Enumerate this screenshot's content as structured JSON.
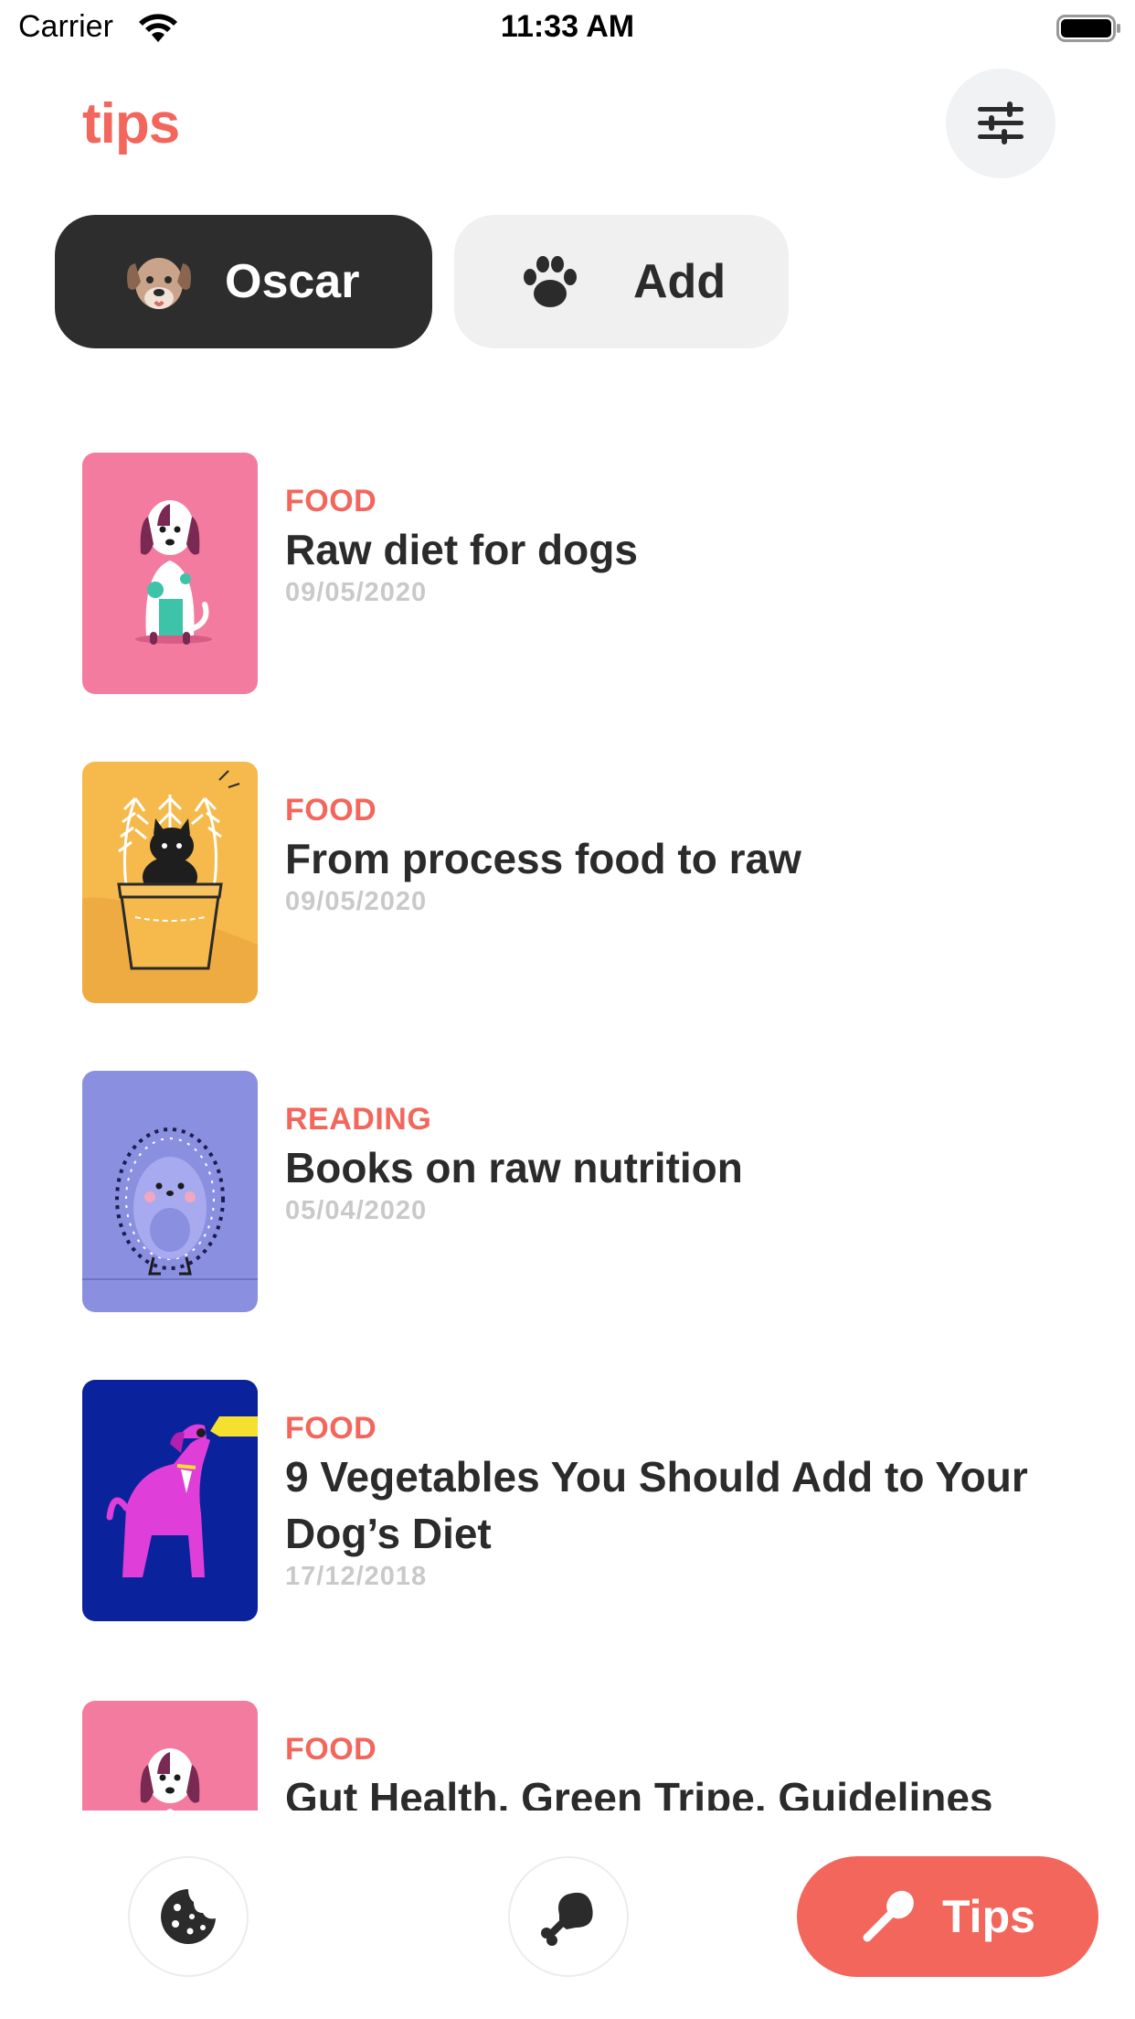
{
  "status_bar": {
    "carrier": "Carrier",
    "time": "11:33 AM"
  },
  "header": {
    "logo": "tips"
  },
  "pets": {
    "selected": "Oscar",
    "add": "Add"
  },
  "articles": [
    {
      "category": "FOOD",
      "title": "Raw diet for dogs",
      "date": "09/05/2020",
      "thumb": "spotted-dog-pink"
    },
    {
      "category": "FOOD",
      "title": "From process food to raw",
      "date": "09/05/2020",
      "thumb": "cat-in-pot-yellow"
    },
    {
      "category": "READING",
      "title": "Books on raw nutrition",
      "date": "05/04/2020",
      "thumb": "hedgehog-purple"
    },
    {
      "category": "FOOD",
      "title": "9 Vegetables You Should Add to Your Dog’s Diet",
      "date": "17/12/2018",
      "thumb": "barking-dog-blue"
    },
    {
      "category": "FOOD",
      "title": "Gut Health, Green Tripe, Guidelines",
      "date": "",
      "thumb": "spotted-dog-pink"
    }
  ],
  "tabbar": {
    "tips_label": "Tips"
  },
  "colors": {
    "accent": "#f2665c",
    "dark": "#2d2d2d",
    "muted": "#c9c9c9"
  }
}
